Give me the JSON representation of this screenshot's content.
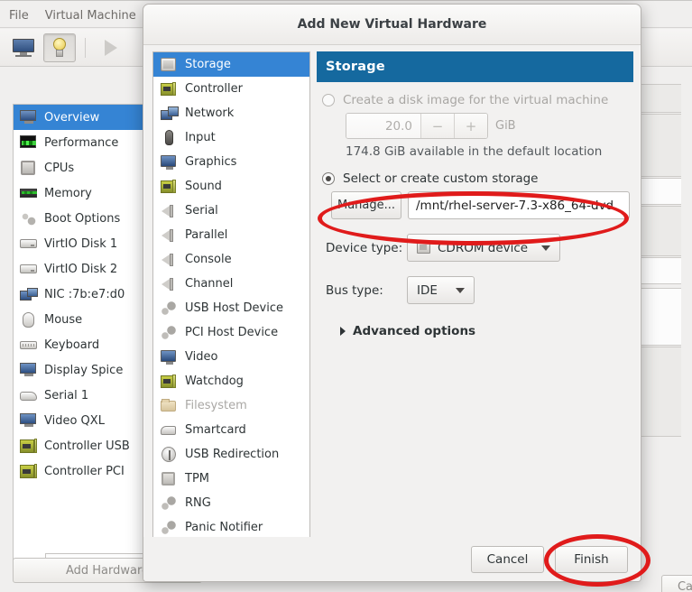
{
  "background_window": {
    "menubar": [
      "File",
      "Virtual Machine"
    ],
    "toolbar": {
      "console_icon": "monitor-icon",
      "details_icon": "lightbulb-icon",
      "run_icon": "play-icon"
    },
    "hardware_list": [
      {
        "label": "Overview",
        "icon": "computer-icon",
        "selected": true
      },
      {
        "label": "Performance",
        "icon": "graph-icon",
        "selected": false
      },
      {
        "label": "CPUs",
        "icon": "cpu-icon",
        "selected": false
      },
      {
        "label": "Memory",
        "icon": "memory-icon",
        "selected": false
      },
      {
        "label": "Boot Options",
        "icon": "gears-icon",
        "selected": false
      },
      {
        "label": "VirtIO Disk 1",
        "icon": "disk-icon",
        "selected": false
      },
      {
        "label": "VirtIO Disk 2",
        "icon": "disk-icon",
        "selected": false
      },
      {
        "label": "NIC :7b:e7:d0",
        "icon": "network-icon",
        "selected": false
      },
      {
        "label": "Mouse",
        "icon": "mouse-icon",
        "selected": false
      },
      {
        "label": "Keyboard",
        "icon": "keyboard-icon",
        "selected": false
      },
      {
        "label": "Display Spice",
        "icon": "display-icon",
        "selected": false
      },
      {
        "label": "Serial 1",
        "icon": "serial-icon",
        "selected": false
      },
      {
        "label": "Video QXL",
        "icon": "display-icon",
        "selected": false
      },
      {
        "label": "Controller USB",
        "icon": "card-icon",
        "selected": false
      },
      {
        "label": "Controller PCI",
        "icon": "card-icon",
        "selected": false
      }
    ],
    "add_hardware_label": "Add Hardware",
    "cancel_label": "Cancel"
  },
  "dialog": {
    "title": "Add New Virtual Hardware",
    "hardware_categories": [
      {
        "label": "Storage",
        "icon": "storage-icon",
        "selected": true,
        "disabled": false
      },
      {
        "label": "Controller",
        "icon": "controller-icon",
        "selected": false,
        "disabled": false
      },
      {
        "label": "Network",
        "icon": "network-icon",
        "selected": false,
        "disabled": false
      },
      {
        "label": "Input",
        "icon": "input-mouse-icon",
        "selected": false,
        "disabled": false
      },
      {
        "label": "Graphics",
        "icon": "graphics-icon",
        "selected": false,
        "disabled": false
      },
      {
        "label": "Sound",
        "icon": "sound-card-icon",
        "selected": false,
        "disabled": false
      },
      {
        "label": "Serial",
        "icon": "serial-port-icon",
        "selected": false,
        "disabled": false
      },
      {
        "label": "Parallel",
        "icon": "parallel-port-icon",
        "selected": false,
        "disabled": false
      },
      {
        "label": "Console",
        "icon": "console-icon",
        "selected": false,
        "disabled": false
      },
      {
        "label": "Channel",
        "icon": "channel-icon",
        "selected": false,
        "disabled": false
      },
      {
        "label": "USB Host Device",
        "icon": "usb-host-icon",
        "selected": false,
        "disabled": false
      },
      {
        "label": "PCI Host Device",
        "icon": "pci-host-icon",
        "selected": false,
        "disabled": false
      },
      {
        "label": "Video",
        "icon": "video-icon",
        "selected": false,
        "disabled": false
      },
      {
        "label": "Watchdog",
        "icon": "watchdog-icon",
        "selected": false,
        "disabled": false
      },
      {
        "label": "Filesystem",
        "icon": "filesystem-icon",
        "selected": false,
        "disabled": true
      },
      {
        "label": "Smartcard",
        "icon": "smartcard-icon",
        "selected": false,
        "disabled": false
      },
      {
        "label": "USB Redirection",
        "icon": "usb-redirect-icon",
        "selected": false,
        "disabled": false
      },
      {
        "label": "TPM",
        "icon": "tpm-icon",
        "selected": false,
        "disabled": false
      },
      {
        "label": "RNG",
        "icon": "rng-icon",
        "selected": false,
        "disabled": false
      },
      {
        "label": "Panic Notifier",
        "icon": "panic-icon",
        "selected": false,
        "disabled": false
      }
    ],
    "storage_panel": {
      "header": "Storage",
      "create_disk_radio": {
        "label": "Create a disk image for the virtual machine",
        "checked": false,
        "enabled": false
      },
      "size_spinner": {
        "value": "20.0",
        "decrement": "−",
        "increment": "+",
        "unit": "GiB",
        "enabled": false
      },
      "available_text": "174.8 GiB available in the default location",
      "custom_storage_radio": {
        "label": "Select or create custom storage",
        "checked": true,
        "enabled": true
      },
      "manage_button": "Manage...",
      "path_value": "/mnt/rhel-server-7.3-x86_64-dvd.",
      "device_type": {
        "label": "Device type:",
        "value": "CDROM device",
        "icon": "cdrom-icon"
      },
      "bus_type": {
        "label": "Bus type:",
        "value": "IDE"
      },
      "advanced_options": {
        "label": "Advanced options",
        "expanded": false,
        "icon": "chevron-right-icon"
      }
    },
    "footer": {
      "cancel": "Cancel",
      "finish": "Finish"
    }
  },
  "annotations": {
    "color": "#e01b1b",
    "shapes": [
      {
        "name": "path-field-highlight",
        "kind": "ellipse"
      },
      {
        "name": "finish-button-highlight",
        "kind": "ellipse"
      }
    ]
  },
  "colors": {
    "pane_header_blue": "#15699f",
    "selection_blue": "#3584d4",
    "dialog_bg": "#f2f1f0",
    "annotation_red": "#e01b1b"
  }
}
